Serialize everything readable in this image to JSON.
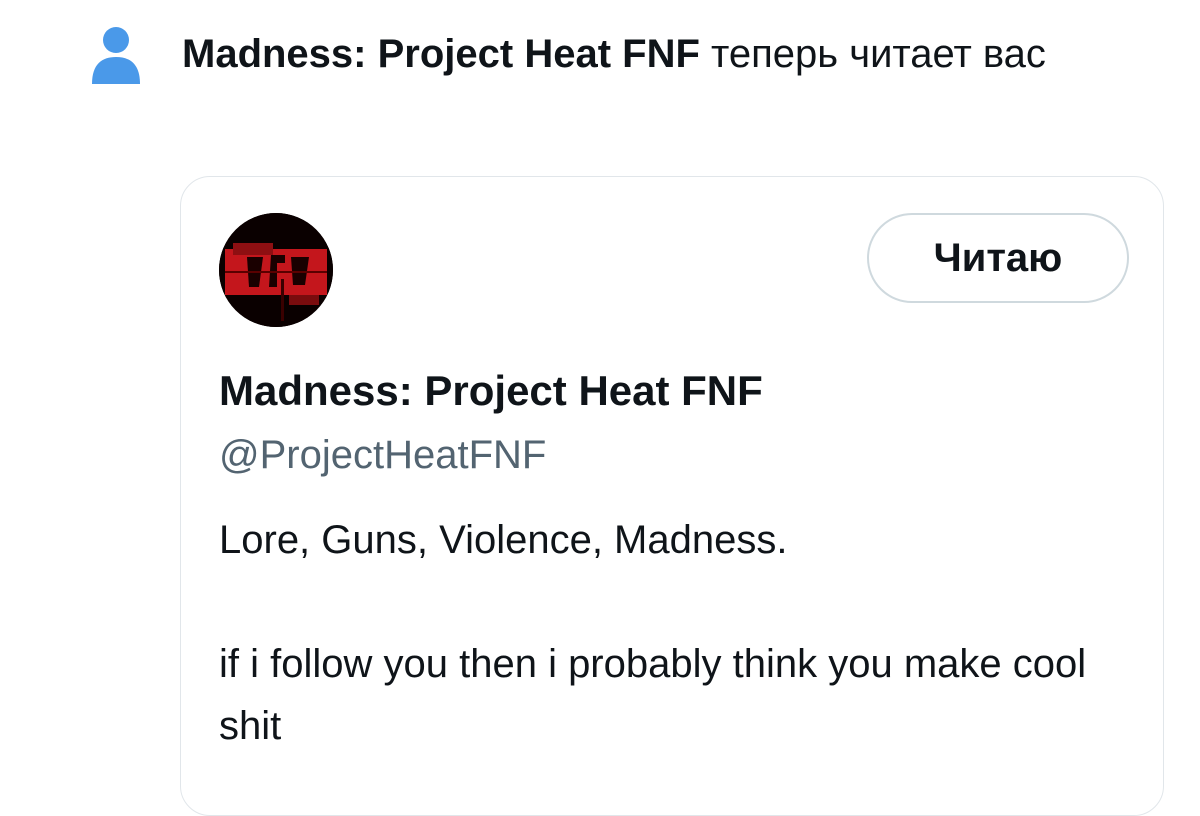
{
  "notification": {
    "icon": "person-icon",
    "account_name": "Madness: Project Heat FNF",
    "message": " теперь читает вас",
    "accent_color": "#4a99e9"
  },
  "card": {
    "avatar": "profile-avatar",
    "follow_button_label": "Читаю",
    "display_name": "Madness: Project Heat FNF",
    "handle": "@ProjectHeatFNF",
    "bio": "Lore, Guns, Violence, Madness.\n\nif i follow you then i probably think you make cool shit"
  }
}
